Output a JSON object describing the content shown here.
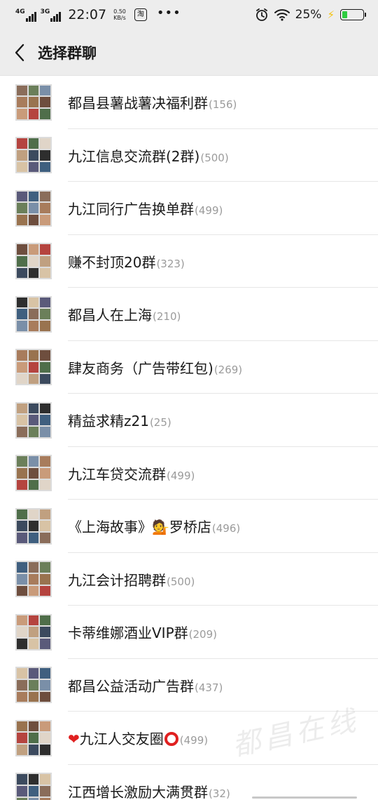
{
  "status_bar": {
    "net1": "4G",
    "net2": "3G",
    "time": "22:07",
    "speed_value": "0.50",
    "speed_unit": "KB/s",
    "app_badge": "淘",
    "more": "•••",
    "battery_percent": "25%",
    "battery_level": 0.25,
    "colors": {
      "battery_fill": "#2ecc40",
      "charging_bolt": "#f4c20d"
    }
  },
  "header": {
    "back_icon": "chevron-left-icon",
    "title": "选择群聊"
  },
  "groups": [
    {
      "name": "都昌县薯战薯决福利群",
      "count": "(156)"
    },
    {
      "name": "九江信息交流群(2群)",
      "count": "(500)"
    },
    {
      "name": "九江同行广告换单群",
      "count": "(499)"
    },
    {
      "name": "赚不封顶20群",
      "count": "(323)"
    },
    {
      "name": "都昌人在上海",
      "count": "(210)"
    },
    {
      "name": "肆友商务（广告带红包)",
      "count": "(269)"
    },
    {
      "name": "精益求精z21",
      "count": "(25)"
    },
    {
      "name": "九江车贷交流群",
      "count": "(499)"
    },
    {
      "name_before": "《上海故事》",
      "name_after": "罗桥店",
      "emoji": "person-tipping-hand-icon",
      "count": "(496)"
    },
    {
      "name": "九江会计招聘群",
      "count": "(500)"
    },
    {
      "name": "卡蒂维娜酒业VIP群",
      "count": "(209)"
    },
    {
      "name": "都昌公益活动广告群",
      "count": "(437)"
    },
    {
      "name": "九江人交友圈",
      "prefix_emoji": "heart-icon",
      "suffix_emoji": "ring-icon",
      "count": "(499)"
    },
    {
      "name": "江西增长激励大满贯群",
      "count": "(32)"
    }
  ],
  "watermark": "都昌在线"
}
